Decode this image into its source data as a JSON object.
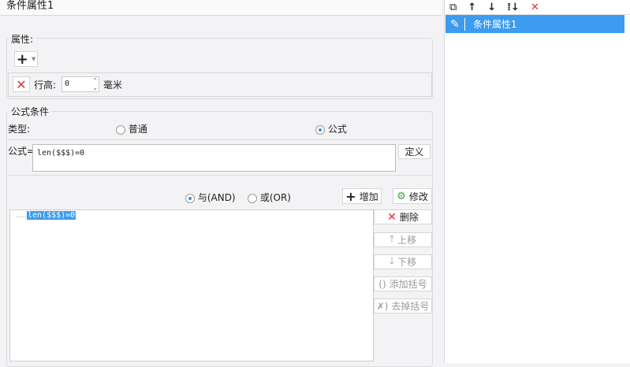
{
  "title": "条件属性1",
  "attr_group": {
    "legend": "属性:",
    "row_height_label": "行高:",
    "row_height_value": "0",
    "unit": "毫米"
  },
  "formula_group": {
    "legend": "公式条件",
    "type_label": "类型:",
    "opt_normal": "普通",
    "opt_formula": "公式",
    "formula_label": "公式=",
    "formula_value": "len($$$)=0",
    "define_btn": "定义",
    "and_label": "与(AND)",
    "or_label": "或(OR)",
    "add_btn": "增加",
    "modify_btn": "修改",
    "conditions": [
      "len($$$)=0"
    ],
    "delete_btn": "删除",
    "up_btn": "上移",
    "down_btn": "下移",
    "add_paren_btn": "添加括号",
    "remove_paren_btn": "去掉括号"
  },
  "right_panel": {
    "items": [
      "条件属性1"
    ]
  },
  "colors": {
    "selection": "#3d9bf0",
    "accent": "#3a8ee6"
  }
}
